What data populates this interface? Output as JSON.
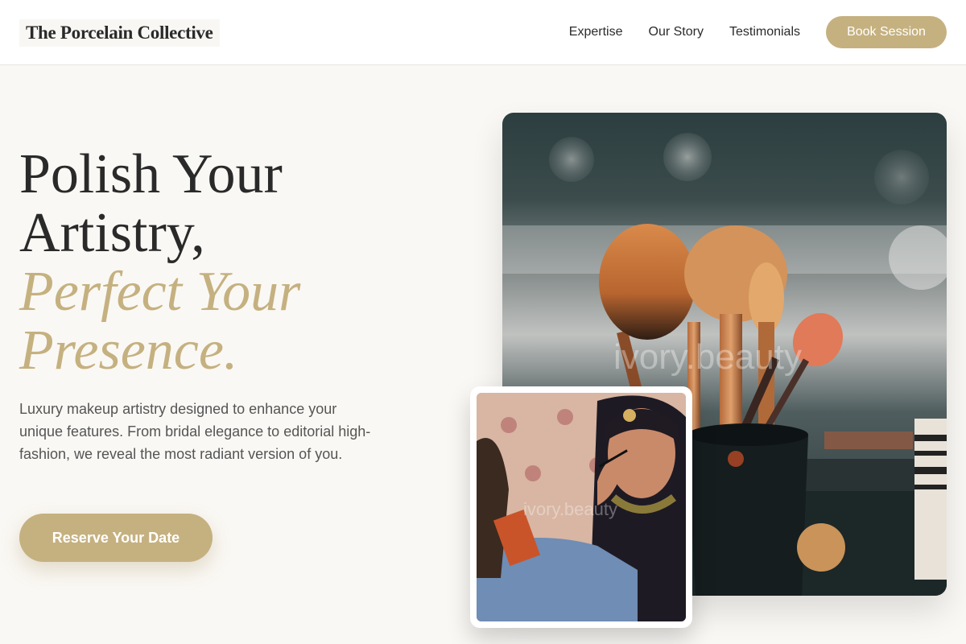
{
  "header": {
    "brand": "The Porcelain Collective",
    "nav": [
      {
        "label": "Expertise"
      },
      {
        "label": "Our Story"
      },
      {
        "label": "Testimonials"
      }
    ],
    "cta_label": "Book Session"
  },
  "hero": {
    "title_line1": "Polish Your",
    "title_line2": "Artistry,",
    "title_accent_line1": "Perfect Your",
    "title_accent_line2": "Presence.",
    "description": "Luxury makeup artistry designed to enhance your unique features. From bridal elegance to editorial high-fashion, we reveal the most radiant version of you.",
    "cta_label": "Reserve Your Date"
  },
  "images": {
    "main_watermark": "ivory.beauty",
    "secondary_watermark": "ivory.beauty"
  },
  "colors": {
    "accent": "#c5b180",
    "text": "#2b2b2b",
    "background": "#faf8f4"
  }
}
